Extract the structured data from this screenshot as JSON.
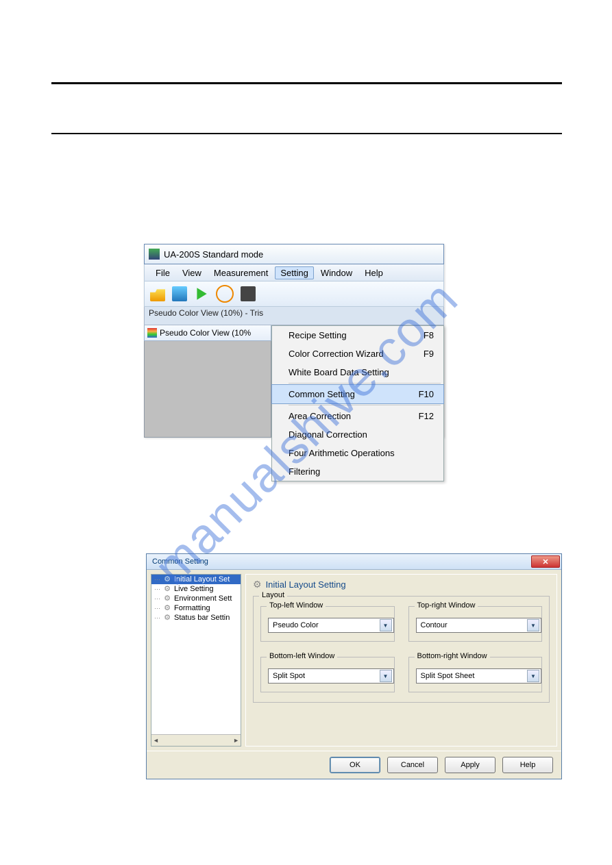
{
  "watermark": "manualshive.com",
  "ss1": {
    "title": "UA-200S Standard mode",
    "menubar": [
      "File",
      "View",
      "Measurement",
      "Setting",
      "Window",
      "Help"
    ],
    "menubar_selected": "Setting",
    "tabline": "Pseudo Color View (10%) - Tris",
    "child_title": "Pseudo Color View (10%",
    "menu": [
      {
        "label": "Recipe Setting",
        "accel": "F8"
      },
      {
        "label": "Color Correction Wizard",
        "accel": "F9"
      },
      {
        "label": "White Board Data Setting",
        "accel": ""
      },
      {
        "sep": true
      },
      {
        "label": "Common Setting",
        "accel": "F10",
        "hl": true
      },
      {
        "sep": true
      },
      {
        "label": "Area Correction",
        "accel": "F12"
      },
      {
        "label": "Diagonal Correction",
        "accel": ""
      },
      {
        "label": "Four Arithmetic Operations",
        "accel": ""
      },
      {
        "label": "Filtering",
        "accel": ""
      }
    ]
  },
  "ss2": {
    "title": "Common Setting",
    "tree": [
      {
        "label": "Initial Layout Set",
        "sel": true
      },
      {
        "label": "Live Setting"
      },
      {
        "label": "Environment Sett"
      },
      {
        "label": "Formatting"
      },
      {
        "label": "Status bar Settin"
      }
    ],
    "pane_title": "Initial Layout Setting",
    "group_label": "Layout",
    "tl_legend": "Top-left Window",
    "tl_value": "Pseudo Color",
    "tr_legend": "Top-right Window",
    "tr_value": "Contour",
    "bl_legend": "Bottom-left Window",
    "bl_value": "Split Spot",
    "br_legend": "Bottom-right Window",
    "br_value": "Split Spot Sheet",
    "buttons": {
      "ok": "OK",
      "cancel": "Cancel",
      "apply": "Apply",
      "help": "Help"
    }
  }
}
